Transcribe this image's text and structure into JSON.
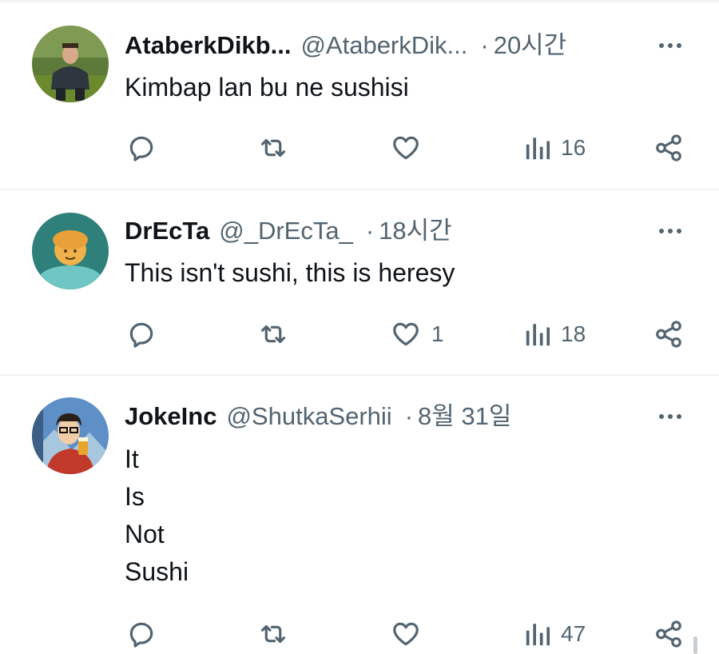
{
  "tweets": [
    {
      "display_name": "AtaberkDikb...",
      "handle": "@AtaberkDik...",
      "separator": "·",
      "time": "20시간",
      "text_lines": [
        "Kimbap lan bu ne sushisi"
      ],
      "replies": "",
      "retweets": "",
      "likes": "",
      "views": "16"
    },
    {
      "display_name": "DrEcTa",
      "handle": "@_DrEcTa_",
      "separator": "·",
      "time": "18시간",
      "text_lines": [
        "This isn't sushi, this is heresy"
      ],
      "replies": "",
      "retweets": "",
      "likes": "1",
      "views": "18"
    },
    {
      "display_name": "JokeInc",
      "handle": "@ShutkaSerhii",
      "separator": "·",
      "time": "8월 31일",
      "text_lines": [
        "It",
        "Is",
        "Not",
        "Sushi"
      ],
      "replies": "",
      "retweets": "",
      "likes": "",
      "views": "47"
    }
  ],
  "colors": {
    "text_primary": "#0f1419",
    "text_secondary": "#536471",
    "divider": "#eff3f4"
  },
  "icons": [
    "reply-icon",
    "retweet-icon",
    "like-icon",
    "views-icon",
    "share-icon",
    "more-icon"
  ]
}
